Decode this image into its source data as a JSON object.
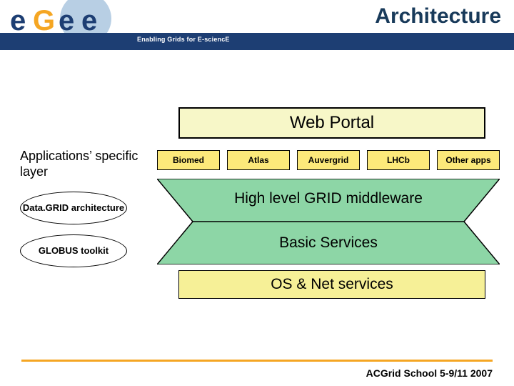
{
  "header": {
    "title": "Architecture",
    "tagline": "Enabling Grids for E-sciencE",
    "logo_text": "eGee"
  },
  "diagram": {
    "web_portal": "Web Portal",
    "applications_label": "Applications’ specific layer",
    "apps": [
      "Biomed",
      "Atlas",
      "Auvergrid",
      "LHCb",
      "Other apps"
    ],
    "middleware": "High level GRID middleware",
    "basic_services": "Basic Services",
    "os_net": "OS & Net services",
    "ellipses": {
      "datagrid": "Data.GRID architecture",
      "globus": "GLOBUS toolkit"
    }
  },
  "footer": "ACGrid School 5-9/11 2007"
}
